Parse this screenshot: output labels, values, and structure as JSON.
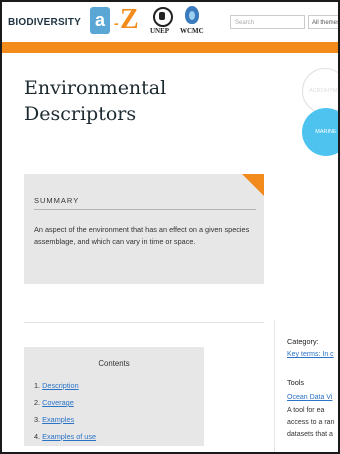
{
  "header": {
    "logo_text": "BIODIVERSITY",
    "az_a": "a",
    "az_dash": "-",
    "az_z": "Z",
    "unep_label": "UNEP",
    "wcmc_label": "WCMC",
    "search_placeholder": "Search",
    "themes_value": "All themes",
    "accent_color": "#f28b1b"
  },
  "page": {
    "title_line1": "Environmental",
    "title_line2": "Descriptors"
  },
  "badges": {
    "outline_label": "ACRONYMS",
    "marine_label": "MARINE",
    "marine_color": "#4fc3f0"
  },
  "summary": {
    "heading": "SUMMARY",
    "text": "An aspect of the environment that has an effect on a given species assemblage, and which can vary in time or space."
  },
  "contents": {
    "heading": "Contents",
    "items": [
      {
        "num": "1.",
        "label": "Description"
      },
      {
        "num": "2.",
        "label": "Coverage"
      },
      {
        "num": "3.",
        "label": "Examples"
      },
      {
        "num": "4.",
        "label": "Examples of use"
      }
    ]
  },
  "sidebar": {
    "category_heading": "Category:",
    "category_link": "Key terms: In c",
    "tools_heading": "Tools",
    "tool_link": "Ocean Data Vi",
    "tool_desc_lines": [
      "A tool for ea",
      "access to a ran",
      "datasets that a"
    ]
  }
}
